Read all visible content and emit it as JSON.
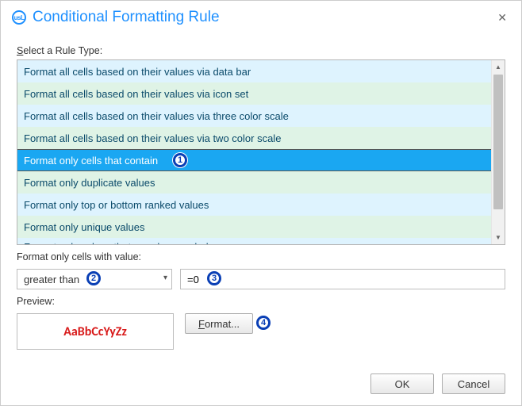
{
  "title": "Conditional Formatting Rule",
  "labels": {
    "select_rule_u": "S",
    "select_rule_rest": "elect a Rule Type:",
    "format_cells_with": "Format only cells with value:",
    "preview": "Preview:"
  },
  "rule_types": [
    "Format all cells based on their values via data bar",
    "Format all cells based on their values via icon set",
    "Format all cells based on their values via three color scale",
    "Format all cells based on their values via two color scale",
    "Format only cells that contain",
    "Format only duplicate values",
    "Format only top or bottom ranked values",
    "Format only unique values",
    "Format only values that are above or below average"
  ],
  "selected_rule_index": 4,
  "condition": {
    "comparison": "greater than",
    "value": "=0"
  },
  "preview": {
    "text": "AaBbCcYyZz",
    "color": "#d81a1a",
    "bold": true
  },
  "buttons": {
    "format_u": "F",
    "format_rest": "ormat...",
    "ok": "OK",
    "cancel": "Cancel"
  },
  "callouts": [
    "1",
    "2",
    "3",
    "4"
  ]
}
